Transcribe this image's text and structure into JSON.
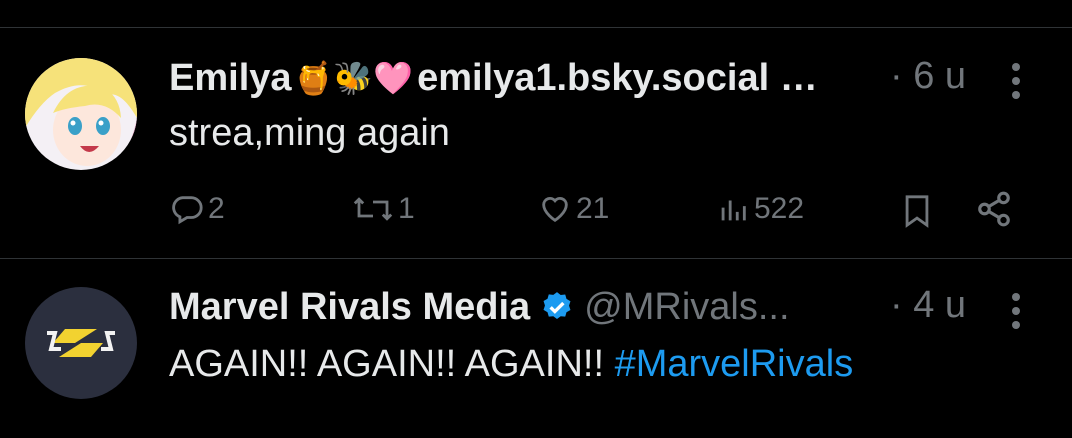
{
  "posts": [
    {
      "display_name": "Emilya",
      "emojis": "🍯🐝🩷",
      "handle": "emilya1.bsky.social …",
      "time": "· 6 u",
      "text": "strea,ming again",
      "actions": {
        "replies": "2",
        "reposts": "1",
        "likes": "21",
        "views": "522"
      }
    },
    {
      "display_name": "Marvel Rivals Media",
      "handle": "@MRivals...",
      "time": "· 4 u",
      "text_plain": "AGAIN!! AGAIN!! AGAIN!! ",
      "hashtag": "#MarvelRivals"
    }
  ],
  "colors": {
    "background": "#000000",
    "text": "#e7e9ea",
    "muted": "#71767b",
    "link": "#1d9bf0",
    "verified": "#1d9bf0"
  },
  "icons": [
    "reply-icon",
    "repost-icon",
    "like-icon",
    "views-icon",
    "bookmark-icon",
    "share-icon",
    "more-icon",
    "verified-badge-icon"
  ]
}
